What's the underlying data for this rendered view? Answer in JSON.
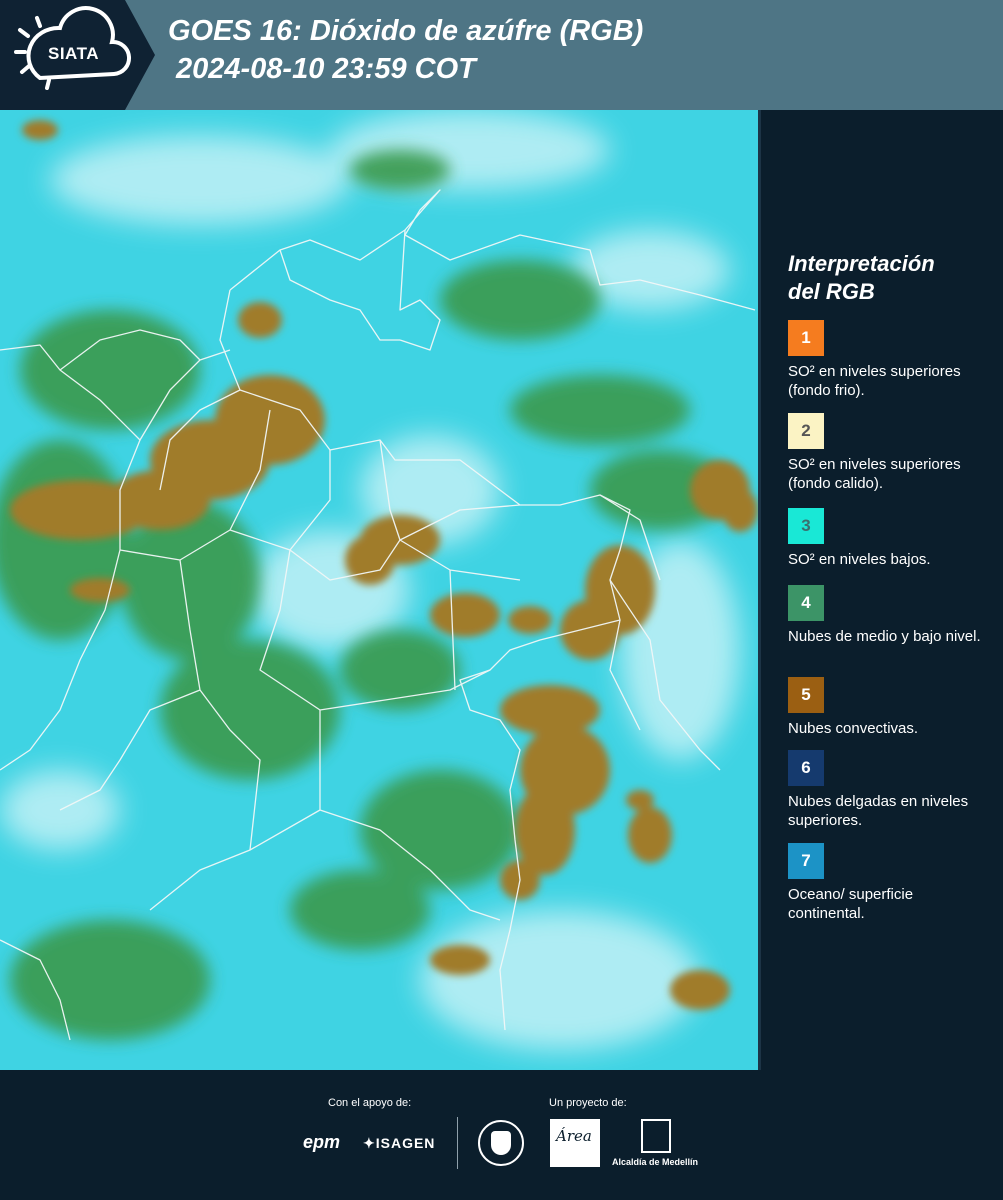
{
  "header": {
    "logo_text": "SIATA",
    "title_line1": "GOES 16: Dióxido de azúfre (RGB)",
    "title_line2": "2024-08-10 23:59 COT"
  },
  "legend": {
    "title_line1": "Interpretación",
    "title_line2": "del RGB",
    "items": [
      {
        "number": "1",
        "color": "#f57c1f",
        "text_color": "#ffffff",
        "description": "SO² en niveles superiores (fondo frio)."
      },
      {
        "number": "2",
        "color": "#fbf3c4",
        "text_color": "#555555",
        "description": "SO² en niveles superiores (fondo calido)."
      },
      {
        "number": "3",
        "color": "#19e8d6",
        "text_color": "#3b6f6e",
        "description": "SO² en niveles bajos."
      },
      {
        "number": "4",
        "color": "#3c9467",
        "text_color": "#ffffff",
        "description": "Nubes de medio y bajo nivel."
      },
      {
        "number": "5",
        "color": "#9b5f12",
        "text_color": "#ffffff",
        "description": "Nubes convectivas."
      },
      {
        "number": "6",
        "color": "#153a6e",
        "text_color": "#ffffff",
        "description": "Nubes delgadas en niveles superiores."
      },
      {
        "number": "7",
        "color": "#1c93c6",
        "text_color": "#ffffff",
        "description": "Oceano/ superficie continental."
      }
    ]
  },
  "footer": {
    "support_label": "Con el apoyo de:",
    "project_label": "Un proyecto de:",
    "sponsors": [
      "epm",
      "ISAGEN"
    ],
    "partners": [
      "Área Metropolitana Valle de Aburrá",
      "Alcaldía de Medellín"
    ]
  },
  "map_colors": {
    "cyan": "#3fd3e3",
    "light": "#c2f1f6",
    "green": "#3b9a4d",
    "brown": "#a07b2c",
    "border": "#f2f7f7"
  }
}
